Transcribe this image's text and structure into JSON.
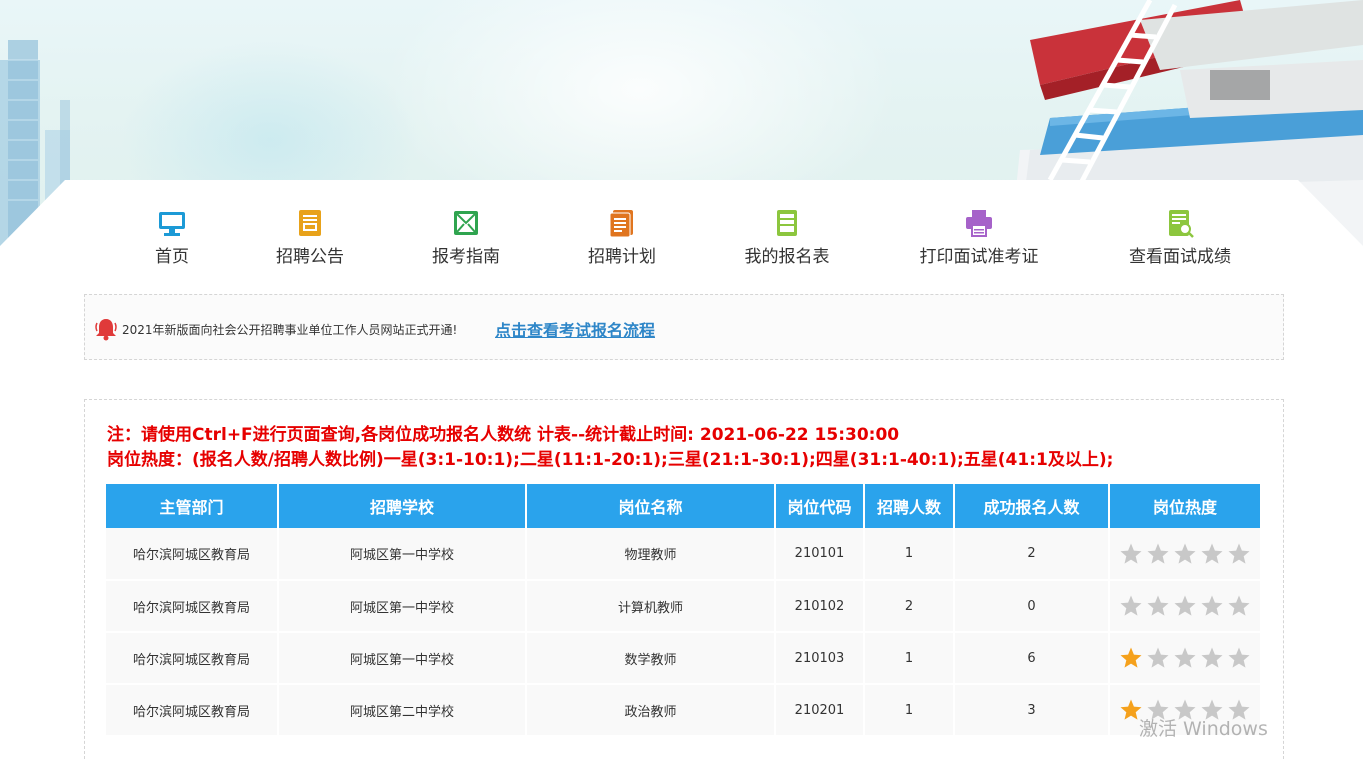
{
  "nav": {
    "items": [
      {
        "label": "首页",
        "icon": "monitor-icon",
        "color": "#1c9ad6"
      },
      {
        "label": "招聘公告",
        "icon": "document-icon",
        "color": "#e8a21a"
      },
      {
        "label": "报考指南",
        "icon": "envelope-icon",
        "color": "#2fa44f"
      },
      {
        "label": "招聘计划",
        "icon": "clipboard-icon",
        "color": "#e0751f"
      },
      {
        "label": "我的报名表",
        "icon": "form-icon",
        "color": "#8cc63e"
      },
      {
        "label": "打印面试准考证",
        "icon": "printer-icon",
        "color": "#a662c9"
      },
      {
        "label": "查看面试成绩",
        "icon": "search-document-icon",
        "color": "#8cc63e"
      }
    ]
  },
  "notice": {
    "message": "2021年新版面向社会公开招聘事业单位工作人员网站正式开通!",
    "link": "点击查看考试报名流程"
  },
  "notes": {
    "line1": "注：请使用Ctrl+F进行页面查询,各岗位成功报名人数统 计表--统计截止时间: 2021-06-22 15:30:00",
    "line2": "岗位热度：(报名人数/招聘人数比例)一星(3:1-10:1);二星(11:1-20:1);三星(21:1-30:1);四星(31:1-40:1);五星(41:1及以上);"
  },
  "table": {
    "headers": [
      "主管部门",
      "招聘学校",
      "岗位名称",
      "岗位代码",
      "招聘人数",
      "成功报名人数",
      "岗位热度"
    ],
    "rows": [
      {
        "dept": "哈尔滨阿城区教育局",
        "school": "阿城区第一中学校",
        "position": "物理教师",
        "code": "210101",
        "hires": "1",
        "applicants": "2",
        "heat": 0
      },
      {
        "dept": "哈尔滨阿城区教育局",
        "school": "阿城区第一中学校",
        "position": "计算机教师",
        "code": "210102",
        "hires": "2",
        "applicants": "0",
        "heat": 0
      },
      {
        "dept": "哈尔滨阿城区教育局",
        "school": "阿城区第一中学校",
        "position": "数学教师",
        "code": "210103",
        "hires": "1",
        "applicants": "6",
        "heat": 1
      },
      {
        "dept": "哈尔滨阿城区教育局",
        "school": "阿城区第二中学校",
        "position": "政治教师",
        "code": "210201",
        "hires": "1",
        "applicants": "3",
        "heat": 1
      }
    ],
    "star_colors": {
      "on": "#f5a11c",
      "off": "#c8c8c8"
    }
  },
  "watermark": "激活 Windows"
}
